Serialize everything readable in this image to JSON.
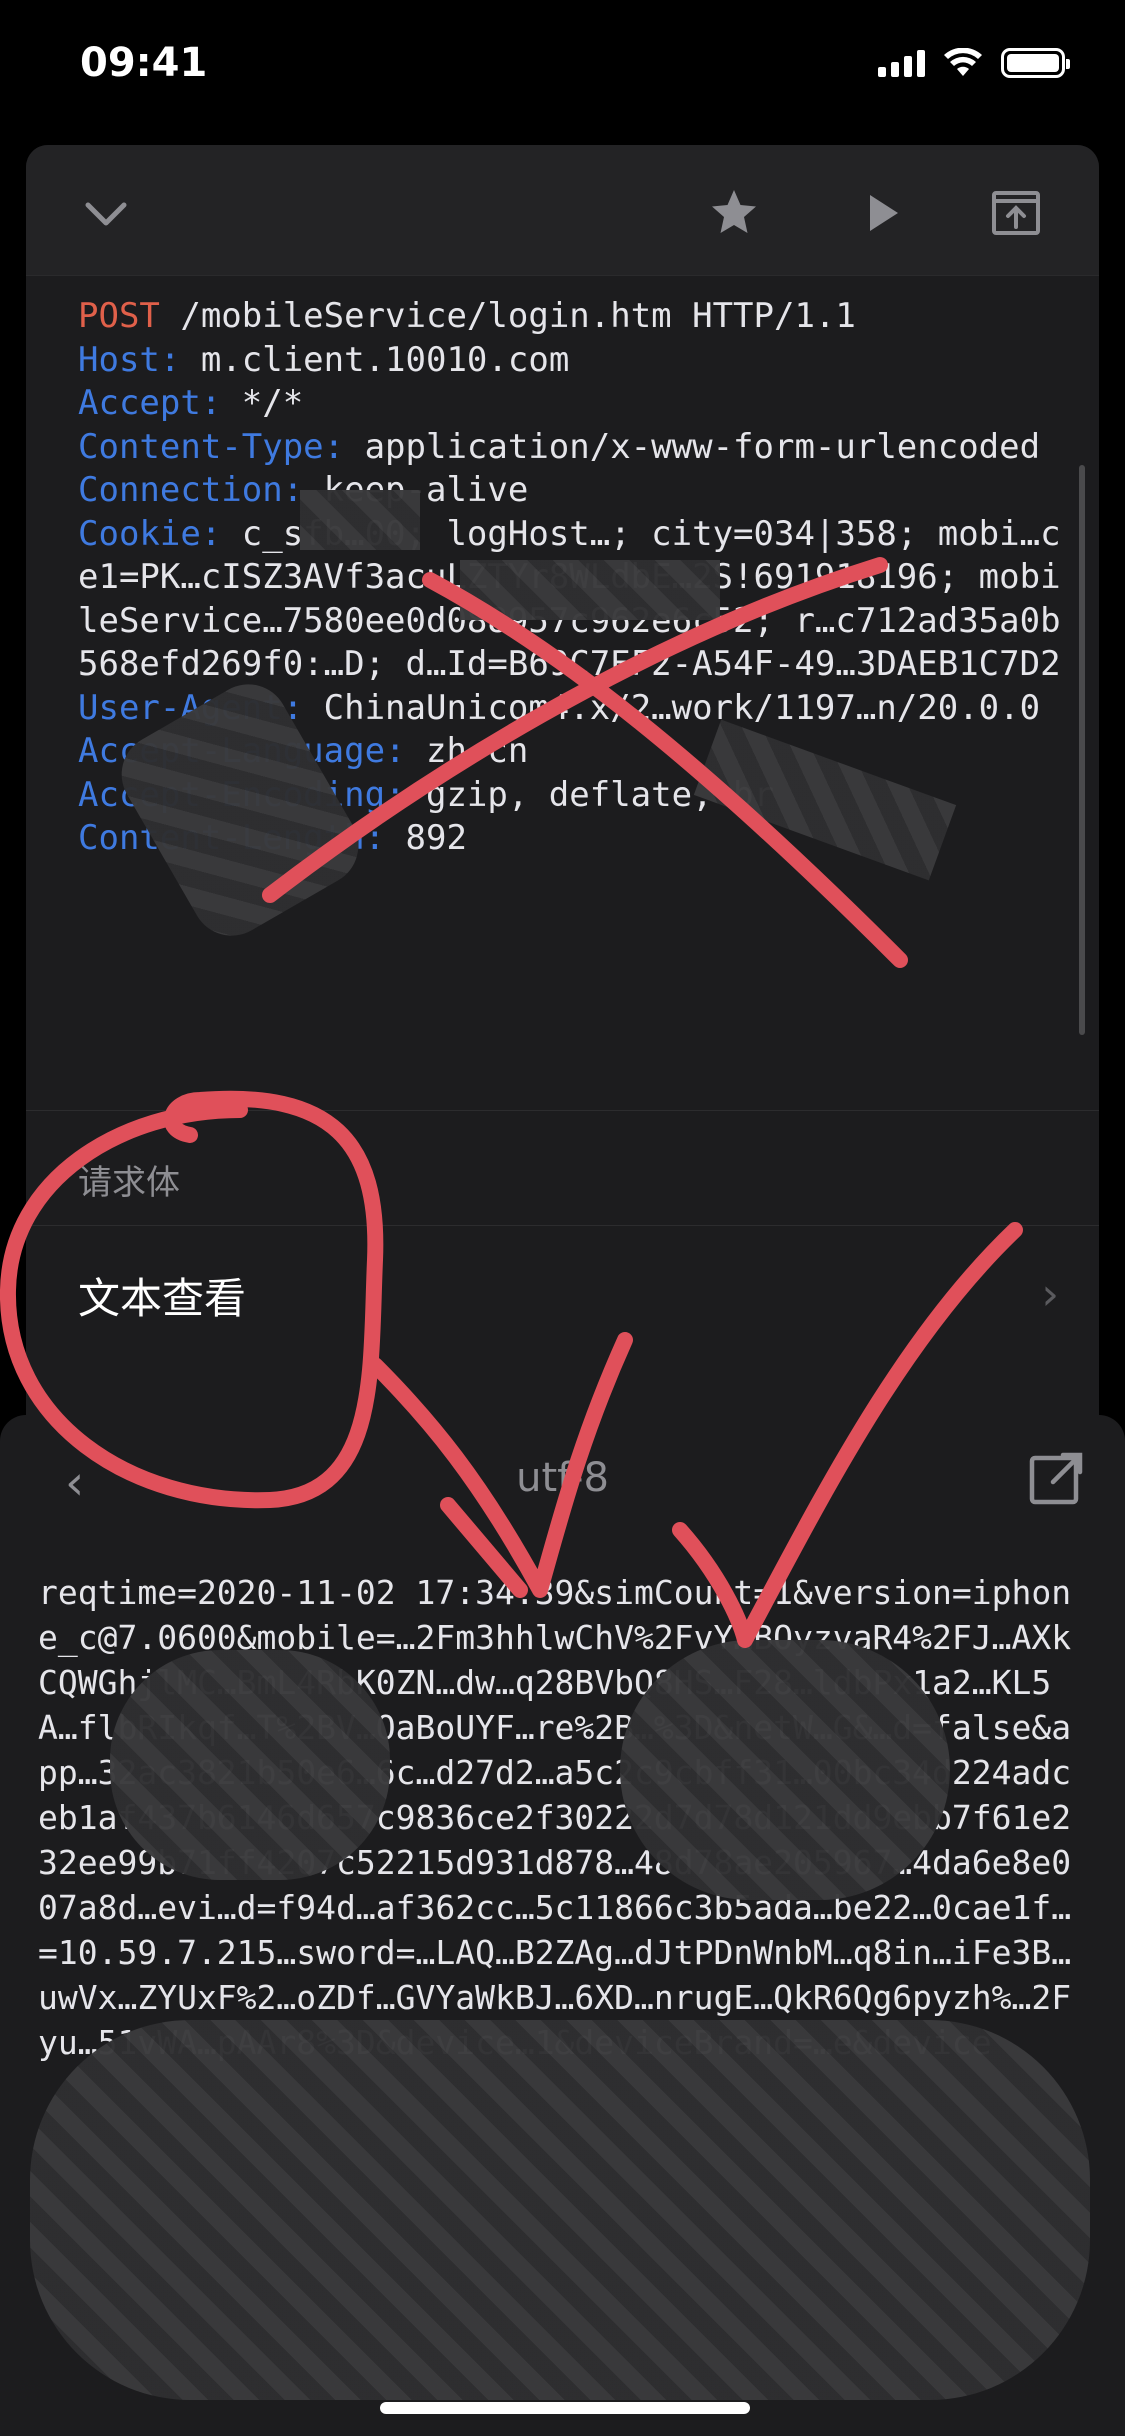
{
  "status_bar": {
    "time": "09:41"
  },
  "request": {
    "method": "POST",
    "request_line_rest": " /mobileService/login.htm HTTP/1.1",
    "headers": [
      {
        "key": "Host:",
        "value": " m.client.10010.com"
      },
      {
        "key": "Accept:",
        "value": " */*"
      },
      {
        "key": "Content-Type:",
        "value": " application/x-www-form-urlencoded"
      },
      {
        "key": "Connection:",
        "value": " keep-alive"
      },
      {
        "key": "Cookie:",
        "value": " c_sfb…00; logHost…; city=034|358; mobi…ce1=PK…cISZ3AVf3acuLZTYr8WLdbE…2S!691918196; mobileService…7580ee0d088957c962e6c52; r…c712ad35a0b568efd269f0:…D; d…Id=B69C7EF2-A54F-49…3DAEB1C7D2"
      },
      {
        "key": "User-Agent:",
        "value": " ChinaUnicom4.x/2…work/1197…n/20.0.0"
      },
      {
        "key": "Accept-Language:",
        "value": " zh-cn"
      },
      {
        "key": "Accept-Encoding:",
        "value": " gzip, deflate, br"
      },
      {
        "key": "Content-Length:",
        "value": " 892"
      }
    ]
  },
  "body_section": {
    "label": "请求体",
    "view_row_label": "文本查看",
    "chevron": "chevron-right-icon"
  },
  "sheet": {
    "encoding": "utf-8",
    "body_text": "reqtime=2020-11-02 17:34:39&simCount=1&version=iphone_c@7.0600&mobile=…2Fm3hhlwChV%2FvY…BOyzvaR4%2FJ…AXkCQWGhjlMC…BmL4RbK0ZN…dw…q28BVbQ8HS…F28…ldbPx1a2…KL5A…flbRIkqf…T%2BV…OaBoUYF…re%2B…%3D&netW…G&…d=false&app…32ac3821b50e6…6c…d27d2…a5c2c9cbff31…00bc34d224adceb1af437b6146d657c9836ce2f30222d7d78d121dd9ebb7f61e232ee99b71ff4207c52215d931d878…48d78ae205967…4da6e8e007a8d…evi…d=f94d…af362cc…5c11866c3b5ada…be22…0cae1f…=10.59.7.215…sword=…LAQ…B2ZAg…dJtPDnWnbM…q8in…iFe3B…uwVx…ZYUxF%2…oZDf…GVYaWkBJ…6XD…nrugE…QkR6Qg6pyzh%…2Fyu…51vWA…pAAr8%3D&device…1&deviceBrand=…e&device"
  },
  "toolbar": {
    "collapse": "chevron-down-icon",
    "favorite": "star-icon",
    "replay": "play-icon",
    "open": "open-in-window-icon"
  },
  "colors": {
    "method": "#e0604a",
    "header_key": "#3f7ae0",
    "annotation": "#e0505a"
  }
}
